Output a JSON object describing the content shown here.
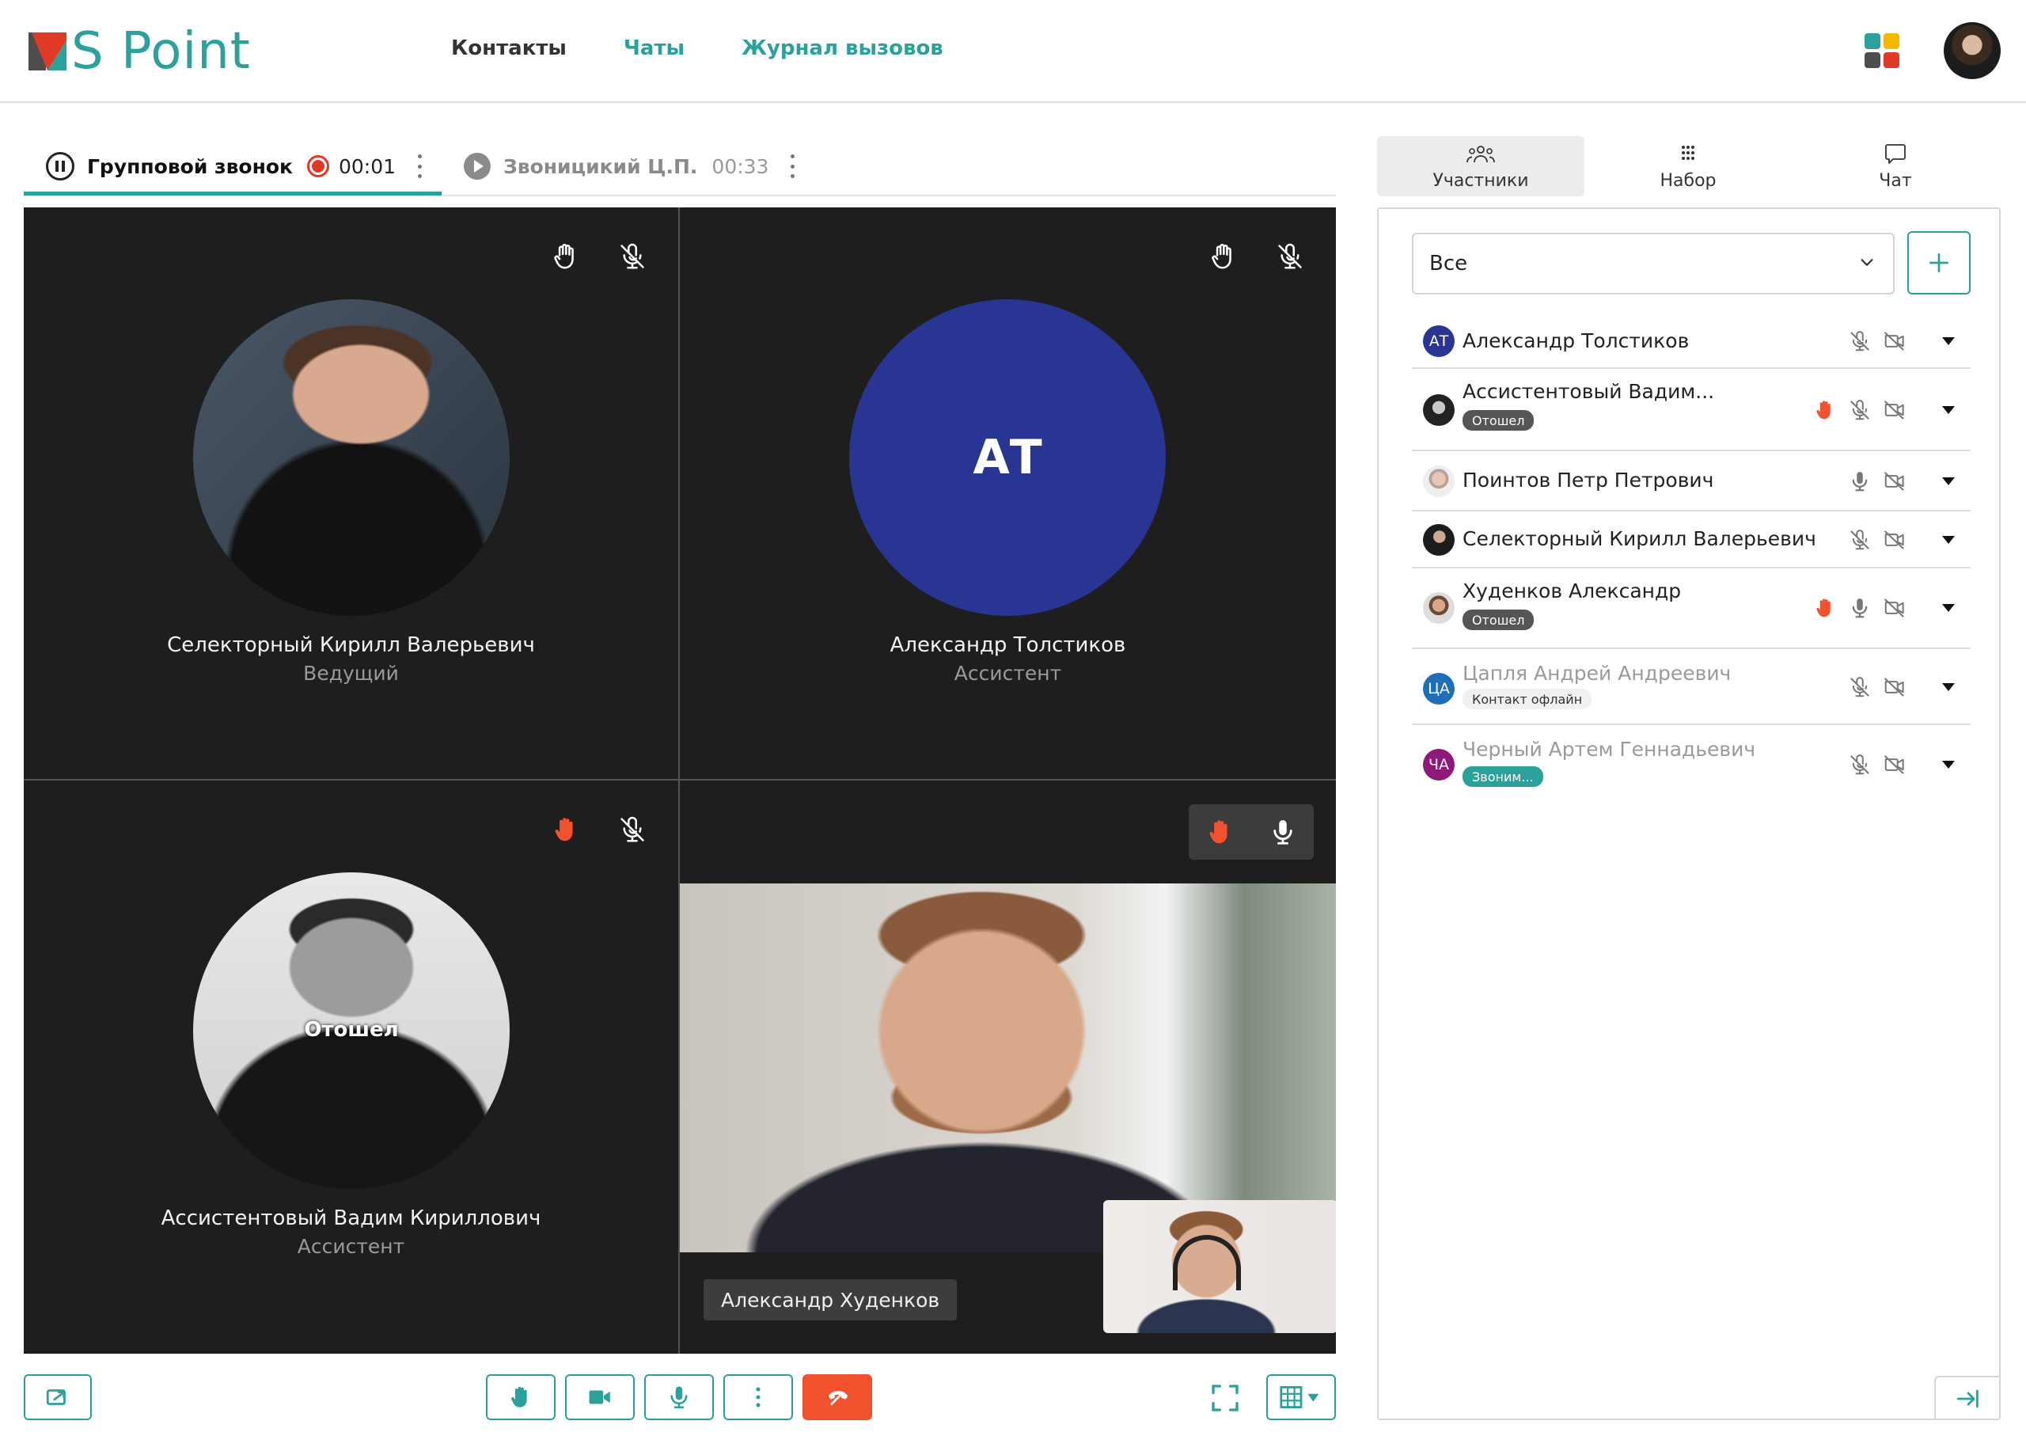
{
  "app": {
    "logo_text": "S Point",
    "brand_color": "#2aa19a",
    "accent_red": "#e03a26"
  },
  "nav": {
    "contacts": "Контакты",
    "chats": "Чаты",
    "call_log": "Журнал вызовов"
  },
  "call_tabs": [
    {
      "title": "Групповой звонок",
      "time": "00:01",
      "state": "active",
      "recording": true
    },
    {
      "title": "Звоницикий Ц.П.",
      "time": "00:33",
      "state": "on-hold"
    }
  ],
  "tiles": [
    {
      "name": "Селекторный Кирилл Валерьевич",
      "role": "Ведущий",
      "hand_raised": false,
      "mic_muted": true
    },
    {
      "name": "Александр Толстиков",
      "role": "Ассистент",
      "initials": "АТ",
      "avatar_color": "#283593",
      "hand_raised": false,
      "mic_muted": true
    },
    {
      "name": "Ассистентовый Вадим Кириллович",
      "role": "Ассистент",
      "status_overlay": "Отошел",
      "hand_raised": true,
      "mic_muted": true
    },
    {
      "name": "Александр Худенков",
      "hand_raised": true,
      "mic_muted": false,
      "video": true
    }
  ],
  "side_tabs": {
    "participants": "Участники",
    "dialpad": "Набор",
    "chat": "Чат"
  },
  "filter": {
    "selected": "Все"
  },
  "participants": [
    {
      "name": "Александр Толстиков",
      "initials": "АТ",
      "color": "#283593",
      "hand": false,
      "mic": false,
      "cam": false
    },
    {
      "name": "Ассистентовый Вадим...",
      "badge": "Отошел",
      "badge_type": "away",
      "hand": true,
      "mic": false,
      "cam": false
    },
    {
      "name": "Поинтов Петр Петрович",
      "hand": false,
      "mic": true,
      "cam": false
    },
    {
      "name": "Селекторный Кирилл Валерьевич",
      "hand": false,
      "mic": false,
      "cam": false
    },
    {
      "name": "Худенков Александр",
      "badge": "Отошел",
      "badge_type": "away",
      "hand": true,
      "mic": true,
      "cam": false
    },
    {
      "name": "Цапля Андрей Андреевич",
      "initials": "ЦА",
      "color": "#1e6fb8",
      "badge": "Контакт офлайн",
      "badge_type": "offline",
      "offline": true,
      "hand": false,
      "mic": false,
      "cam": false
    },
    {
      "name": "Черный Артем Геннадьевич",
      "initials": "ЧА",
      "color": "#8e1a78",
      "badge": "Звоним...",
      "badge_type": "calling",
      "offline": true,
      "hand": false,
      "mic": false,
      "cam": false
    }
  ]
}
